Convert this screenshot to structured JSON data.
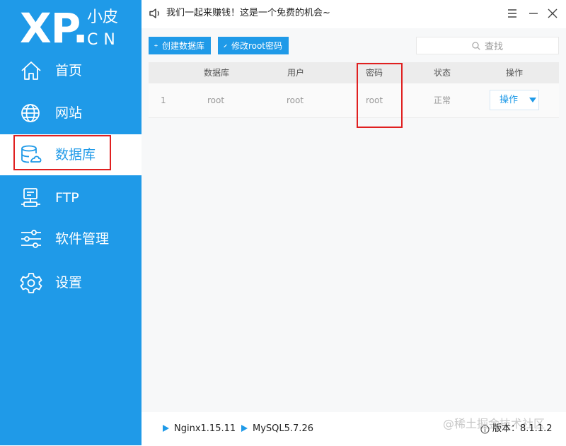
{
  "logo": {
    "main": "XP.",
    "sub_top": "小皮",
    "sub_bottom": "CN"
  },
  "sidebar": {
    "items": [
      {
        "label": "首页",
        "icon": "home-icon"
      },
      {
        "label": "网站",
        "icon": "globe-icon"
      },
      {
        "label": "数据库",
        "icon": "database-icon",
        "active": true
      },
      {
        "label": "FTP",
        "icon": "server-icon"
      },
      {
        "label": "软件管理",
        "icon": "sliders-icon"
      },
      {
        "label": "设置",
        "icon": "gear-icon"
      }
    ]
  },
  "topbar": {
    "notice": "我们一起来赚钱！这是一个免费的机会~"
  },
  "toolbar": {
    "create_label": "创建数据库",
    "modify_label": "修改root密码",
    "search_placeholder": "查找"
  },
  "table": {
    "headers": [
      "数据库",
      "用户",
      "密码",
      "状态",
      "操作"
    ],
    "rows": [
      {
        "index": "1",
        "database": "root",
        "user": "root",
        "password": "root",
        "status": "正常",
        "action": "操作"
      }
    ]
  },
  "statusbar": {
    "nginx": "Nginx1.15.11",
    "mysql": "MySQL5.7.26",
    "watermark": "@稀土掘金技术社区",
    "version": "版本：8.1.1.2"
  },
  "colors": {
    "accent": "#1f9ae8",
    "highlight": "#e02020"
  }
}
